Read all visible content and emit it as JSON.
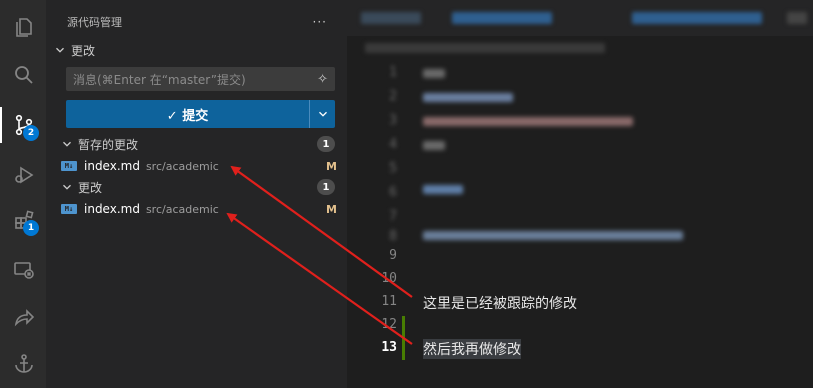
{
  "activity_bar": {
    "items": [
      {
        "icon": "files-icon"
      },
      {
        "icon": "search-icon"
      },
      {
        "icon": "source-control-icon",
        "badge": "2"
      },
      {
        "icon": "run-debug-icon"
      },
      {
        "icon": "extensions-icon",
        "badge": "1"
      },
      {
        "icon": "remote-explorer-icon"
      },
      {
        "icon": "share-icon"
      },
      {
        "icon": "anchor-icon"
      }
    ]
  },
  "sidebar": {
    "title": "源代码管理",
    "more": "···",
    "section_title": "更改",
    "message_placeholder": "消息(⌘Enter 在“master”提交)",
    "commit_label": "✓ 提交",
    "staged": {
      "title": "暂存的更改",
      "count": "1",
      "files": [
        {
          "name": "index.md",
          "path": "src/academic",
          "status": "M",
          "icon_text": "M↓"
        }
      ]
    },
    "changes": {
      "title": "更改",
      "count": "1",
      "files": [
        {
          "name": "index.md",
          "path": "src/academic",
          "status": "M",
          "icon_text": "M↓"
        }
      ]
    }
  },
  "editor": {
    "visible_lines": [
      {
        "num": "9"
      },
      {
        "num": "10"
      },
      {
        "num": "11",
        "text": "这里是已经被跟踪的修改"
      },
      {
        "num": "12"
      },
      {
        "num": "13",
        "text": "然后我再做修改"
      }
    ]
  },
  "colors": {
    "accent": "#0e639c",
    "badge": "#0078d4",
    "modified": "#e2c08d",
    "arrow": "#e0201c",
    "gutter_added": "#487e02"
  }
}
